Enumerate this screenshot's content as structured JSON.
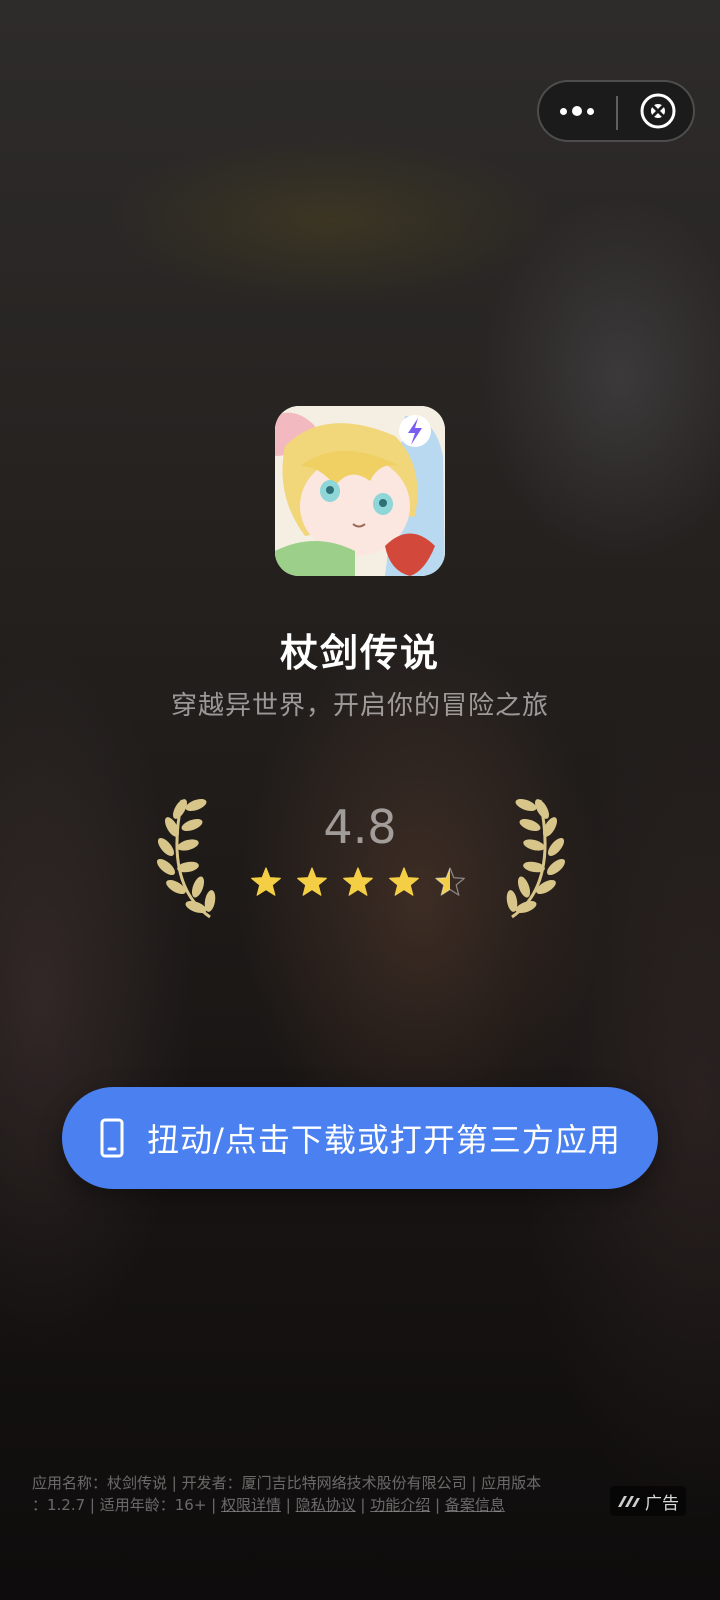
{
  "capsule": {
    "more_icon": "more-dots-icon",
    "close_icon": "close-target-icon"
  },
  "app": {
    "name": "杖剑传说",
    "slogan": "穿越异世界，开启你的冒险之旅"
  },
  "rating": {
    "value": "4.8",
    "stars": 4.5,
    "max_stars": 5
  },
  "cta": {
    "label": "扭动/点击下载或打开第三方应用",
    "icon": "phone-icon"
  },
  "footer": {
    "line1": "应用名称：杖剑传说 | 开发者：厦门吉比特网络技术股份有限公司 | 应用版本",
    "version_prefix": "：1.2.7 | 适用年龄：16+ | ",
    "links": [
      "权限详情",
      "隐私协议",
      "功能介绍",
      "备案信息"
    ],
    "sep": " | "
  },
  "ad_badge": {
    "label": "广告",
    "icon": "ad-logo-icon"
  },
  "colors": {
    "cta": "#4a80f0",
    "star": "#f4cf45",
    "laurel": "#d8c58a"
  }
}
